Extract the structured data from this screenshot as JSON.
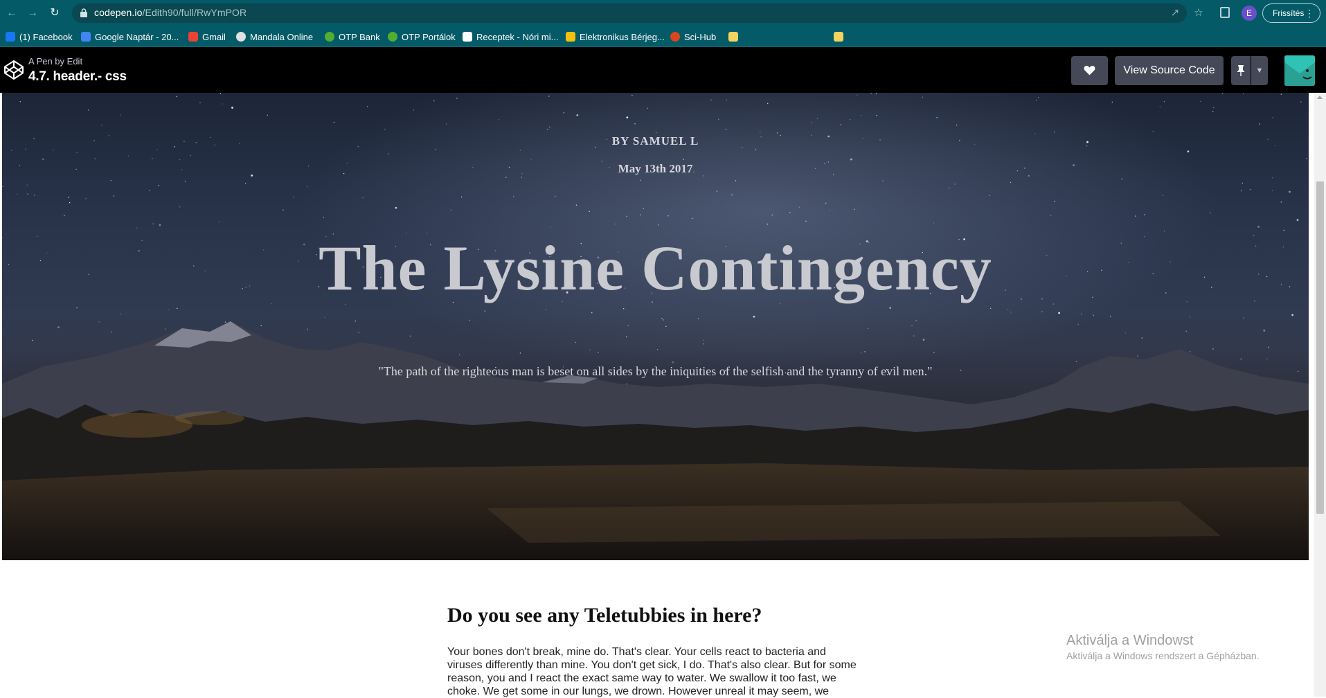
{
  "browser": {
    "url_host": "codepen.io",
    "url_path": "/Edith90/full/RwYmPOR",
    "profile_initial": "E",
    "update_label": "Frissítés",
    "bookmarks": [
      {
        "label": "(1) Facebook",
        "icon": "facebook-icon",
        "color": "#1877f2"
      },
      {
        "label": "Google Naptár - 20...",
        "icon": "calendar-icon",
        "color": "#4285f4"
      },
      {
        "label": "Gmail",
        "icon": "gmail-icon",
        "color": "#ea4335"
      },
      {
        "label": "Mandala Online",
        "icon": "mandala-icon",
        "color": "#e0e0e0"
      },
      {
        "label": "OTP Bank",
        "icon": "otp-icon",
        "color": "#52ae30"
      },
      {
        "label": "OTP Portálok",
        "icon": "otp-portal-icon",
        "color": "#52ae30"
      },
      {
        "label": "Receptek - Nóri mi...",
        "icon": "recipe-icon",
        "color": "#ffffff"
      },
      {
        "label": "Elektronikus Bérjeg...",
        "icon": "payslip-icon",
        "color": "#f4c20d"
      },
      {
        "label": "Sci-Hub",
        "icon": "scihub-icon",
        "color": "#d9471c"
      },
      {
        "label": "",
        "icon": "folder-icon",
        "color": "#f4d35e"
      },
      {
        "label": "",
        "icon": "folder-icon",
        "color": "#f4d35e"
      }
    ]
  },
  "codepen": {
    "byline": "A Pen by Edit",
    "title": "4.7. header.- css",
    "view_source_label": "View Source Code"
  },
  "hero": {
    "byline": "BY SAMUEL L",
    "date": "May 13th 2017",
    "title": "The Lysine Contingency",
    "quote": "\"The path of the righteous man is beset on all sides by the iniquities of the selfish and the tyranny of evil men.\""
  },
  "article": {
    "heading": "Do you see any Teletubbies in here?",
    "body": "Your bones don't break, mine do. That's clear. Your cells react to bacteria and viruses differently than mine. You don't get sick, I do. That's also clear. But for some reason, you and I react the exact same way to water. We swallow it too fast, we choke. We get some in our lungs, we drown. However unreal it may seem, we"
  },
  "watermark": {
    "line1": "Aktiválja a Windowst",
    "line2": "Aktiválja a Windows rendszert a Gépházban."
  }
}
